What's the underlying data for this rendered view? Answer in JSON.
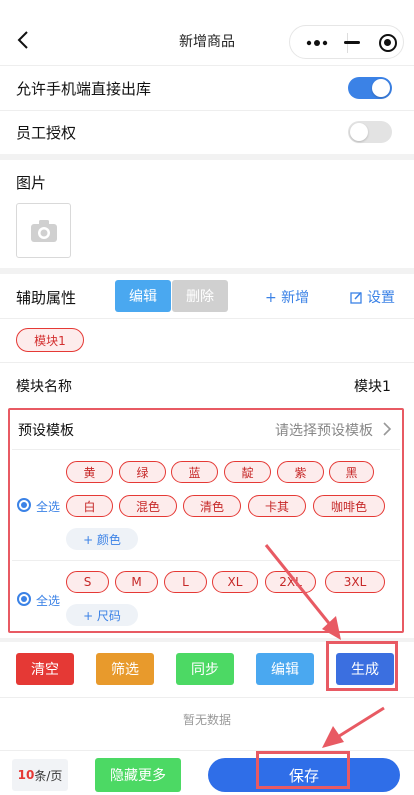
{
  "header": {
    "title": "新增商品"
  },
  "settings": {
    "allow_label": "允许手机端直接出库",
    "staff_label": "员工授权"
  },
  "picture_label": "图片",
  "aux": {
    "label": "辅助属性",
    "edit": "编辑",
    "delete": "删除",
    "add": "+ 新增",
    "settings": "设置"
  },
  "module_tag": "模块1",
  "module_name": {
    "label": "模块名称",
    "value": "模块1"
  },
  "preset": {
    "label": "预设模板",
    "placeholder": "请选择预设模板"
  },
  "colors": {
    "select_all": "全选",
    "items": [
      "黄",
      "绿",
      "蓝",
      "靛",
      "紫",
      "黑",
      "白",
      "混色",
      "清色",
      "卡其",
      "咖啡色"
    ],
    "add": "+ 颜色"
  },
  "sizes": {
    "select_all": "全选",
    "items": [
      "S",
      "M",
      "L",
      "XL",
      "2XL",
      "3XL"
    ],
    "add": "+ 尺码"
  },
  "actions": {
    "clear": "清空",
    "filter": "筛选",
    "sync": "同步",
    "edit": "编辑",
    "generate": "生成"
  },
  "empty_text": "暂无数据",
  "footer": {
    "page_size_num": "10",
    "page_size_unit": "条/页",
    "hide_more": "隐藏更多",
    "save": "保存"
  },
  "colors_theme": {
    "accent": "#3b82e6",
    "red": "#e53935",
    "orange": "#e89a2c",
    "green": "#4cd964",
    "light_blue": "#4aa8f0",
    "gray": "#cfcfcf"
  }
}
